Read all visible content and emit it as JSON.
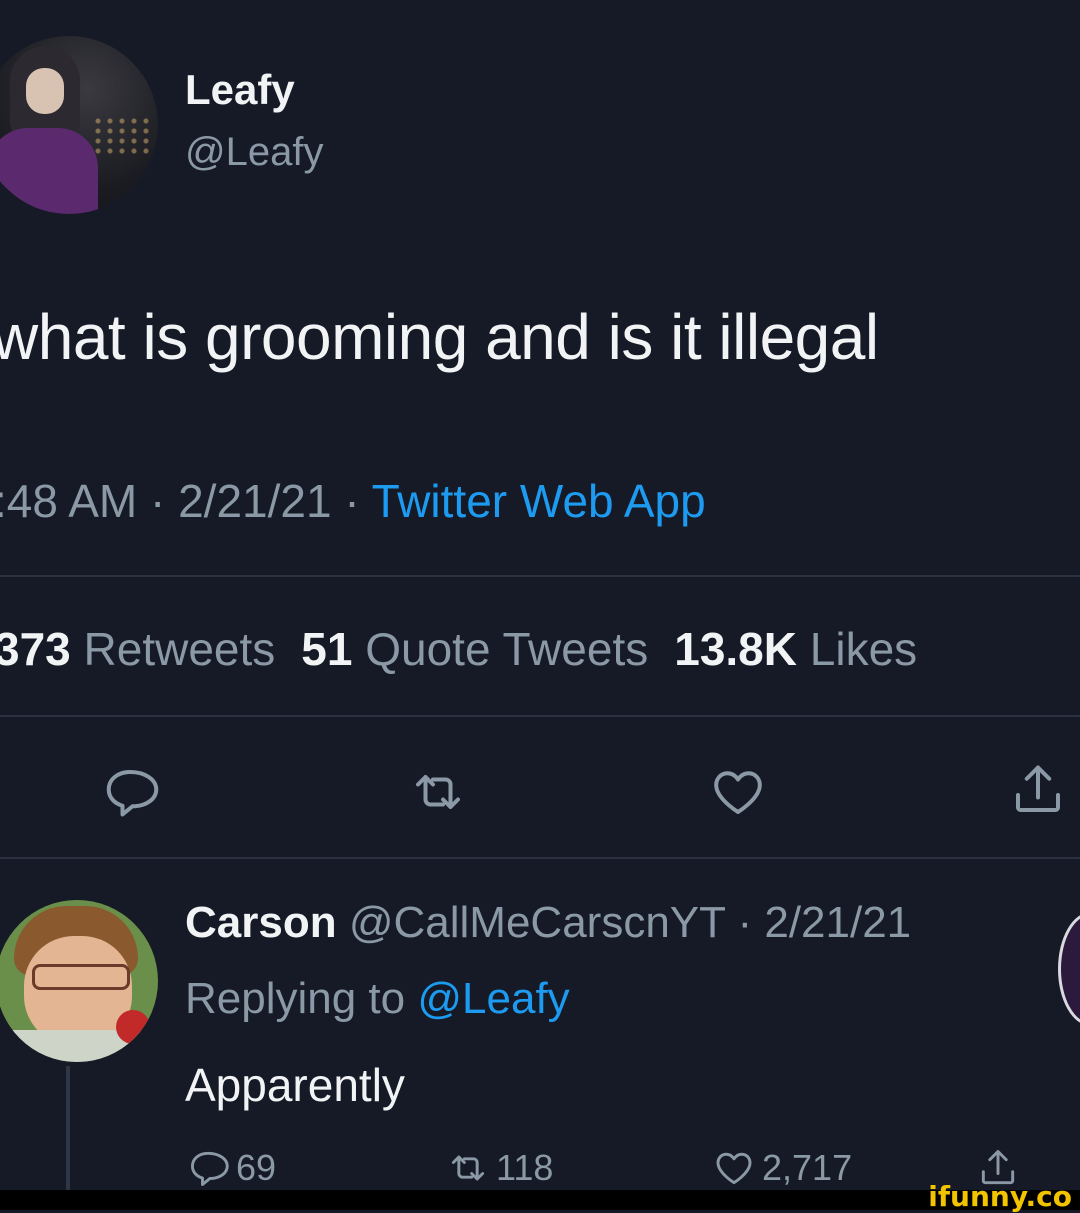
{
  "tweet": {
    "display_name": "Leafy",
    "handle": "@Leafy",
    "text": "what is grooming and is it illegal",
    "time": ":48 AM",
    "date": "2/21/21",
    "source": "Twitter Web App",
    "separator": "·",
    "stats": {
      "retweets_count": "373",
      "retweets_label": "Retweets",
      "quotes_count": "51",
      "quotes_label": "Quote Tweets",
      "likes_count": "13.8K",
      "likes_label": "Likes"
    },
    "actions": [
      "reply-icon",
      "retweet-icon",
      "like-icon",
      "share-icon"
    ]
  },
  "reply": {
    "display_name": "Carson",
    "handle": "@CallMeCarscnYT",
    "date": "2/21/21",
    "replying_prefix": "Replying to",
    "replying_to": "@Leafy",
    "text": "Apparently",
    "reply_count": "69",
    "retweet_count": "118",
    "like_count": "2,717"
  },
  "watermark": "ifunny.co",
  "colors": {
    "background": "#151a26",
    "accent": "#1d9bf0",
    "muted": "#8b98a5",
    "watermark": "#f2c400"
  }
}
